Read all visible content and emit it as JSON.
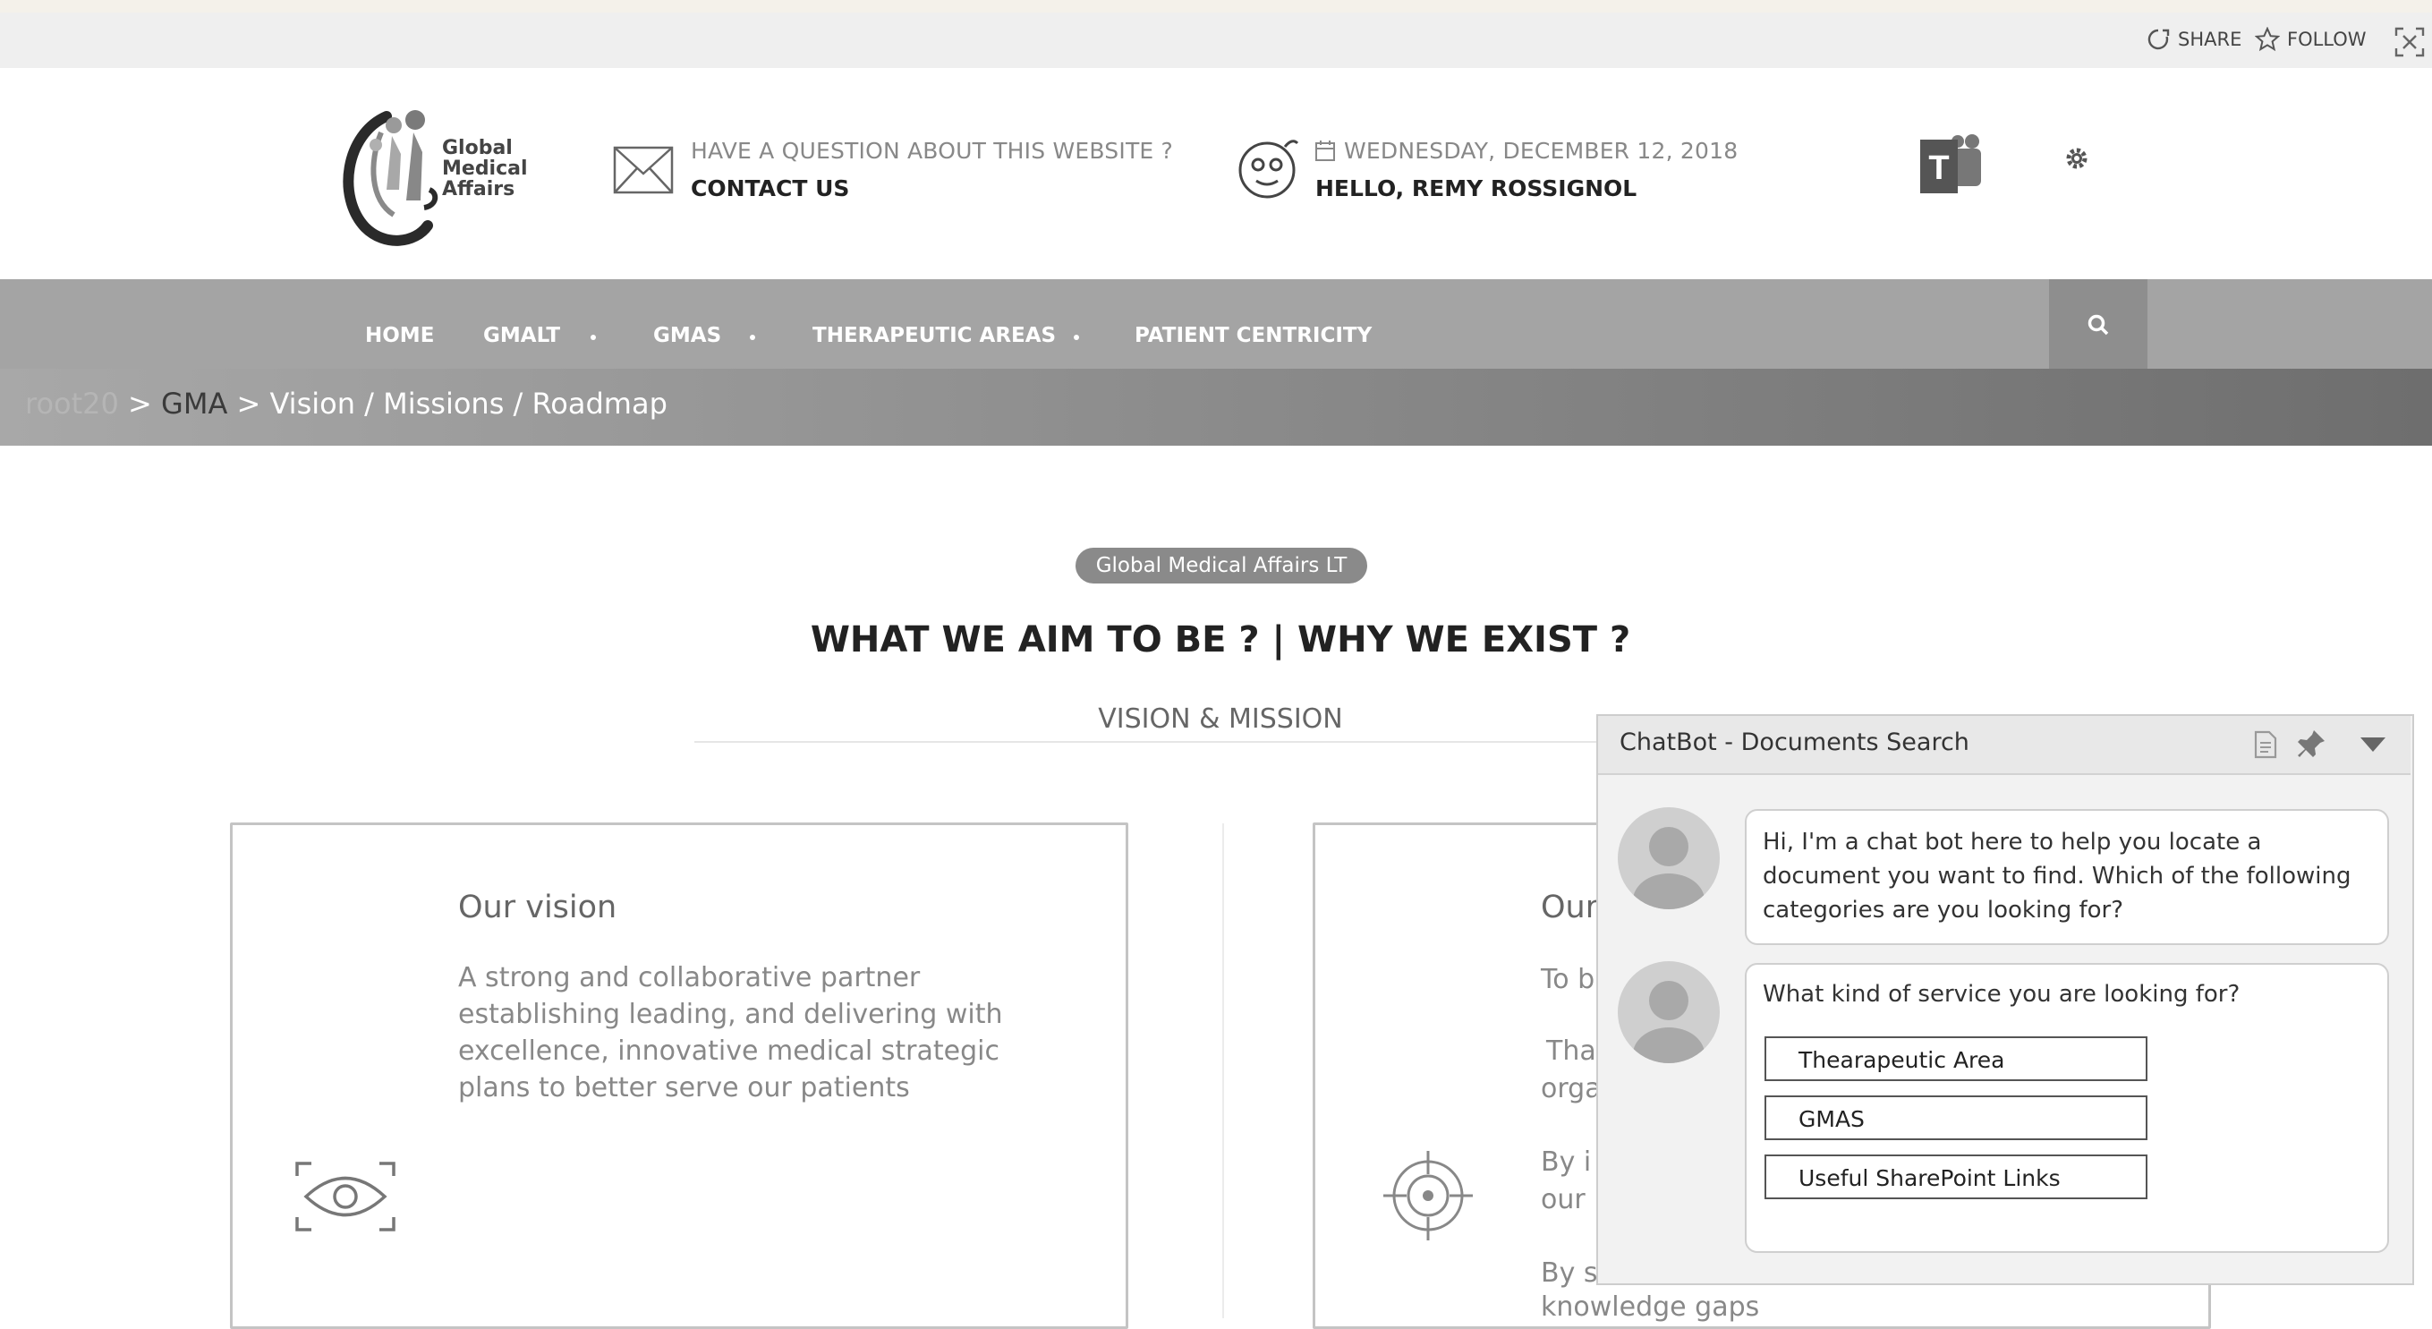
{
  "suite": {
    "share_label": "SHARE",
    "follow_label": "FOLLOW"
  },
  "header": {
    "logo_lines": [
      "Global",
      "Medical",
      "Affairs"
    ],
    "question_label": "HAVE A QUESTION ABOUT THIS WEBSITE ?",
    "contact_label": "CONTACT US",
    "date_label": "WEDNESDAY, DECEMBER 12, 2018",
    "greeting": "HELLO, REMY ROSSIGNOL"
  },
  "nav": {
    "items": [
      {
        "label": "HOME"
      },
      {
        "label": "GMALT"
      },
      {
        "label": "GMAS"
      },
      {
        "label": "THERAPEUTIC AREAS"
      },
      {
        "label": "PATIENT CENTRICITY"
      }
    ]
  },
  "breadcrumb": {
    "root": "root20",
    "sep1": " > ",
    "gma": "GMA",
    "sep2": " > ",
    "current": "Vision / Missions / Roadmap"
  },
  "main": {
    "pill": "Global Medical Affairs LT",
    "title": "WHAT WE AIM TO BE ? | WHY WE EXIST ?",
    "subtitle": "VISION & MISSION",
    "vision": {
      "title": "Our vision",
      "lines": [
        "A strong and collaborative partner",
        "establishing leading, and delivering with",
        "excellence, innovative medical strategic",
        "plans to better serve our patients"
      ]
    },
    "mission": {
      "title": "Our",
      "lines": [
        "To b",
        "Tha",
        "orga",
        "By i",
        "our",
        "By s",
        "knowledge gaps"
      ]
    }
  },
  "chatbot": {
    "title": "ChatBot - Documents Search",
    "message1": [
      "Hi, I'm a chat bot here to help you locate a",
      "document you want to find. Which of the following",
      "categories are you looking for?"
    ],
    "message2": "What kind of service you are looking for?",
    "options": [
      "Thearapeutic Area",
      "GMAS",
      "Useful SharePoint Links"
    ]
  }
}
